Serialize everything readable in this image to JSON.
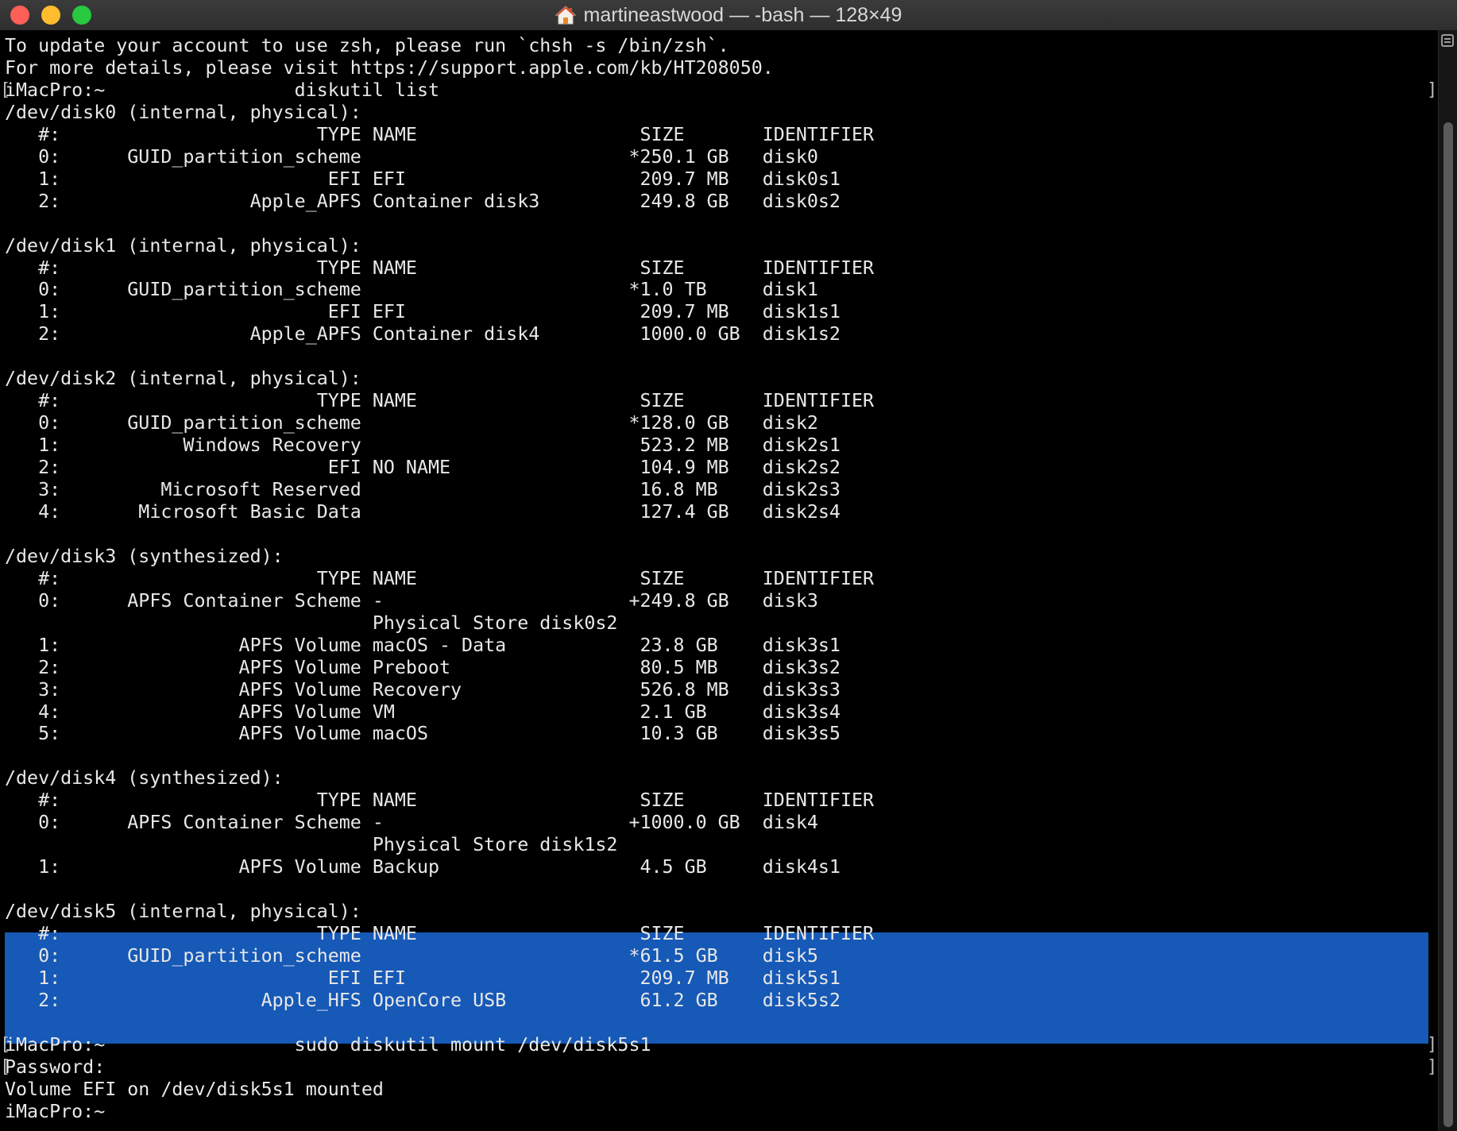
{
  "window": {
    "title": "martineastwood — -bash — 128×49",
    "controls": [
      "close",
      "minimize",
      "maximize"
    ],
    "title_icon": "home-icon"
  },
  "terminal": {
    "lines": [
      "To update your account to use zsh, please run `chsh -s /bin/zsh`.",
      "For more details, please visit https://support.apple.com/kb/HT208050.",
      "iMacPro:~                 diskutil list",
      "/dev/disk0 (internal, physical):",
      "   #:                       TYPE NAME                    SIZE       IDENTIFIER",
      "   0:      GUID_partition_scheme                        *250.1 GB   disk0",
      "   1:                        EFI EFI                     209.7 MB   disk0s1",
      "   2:                 Apple_APFS Container disk3         249.8 GB   disk0s2",
      "",
      "/dev/disk1 (internal, physical):",
      "   #:                       TYPE NAME                    SIZE       IDENTIFIER",
      "   0:      GUID_partition_scheme                        *1.0 TB     disk1",
      "   1:                        EFI EFI                     209.7 MB   disk1s1",
      "   2:                 Apple_APFS Container disk4         1000.0 GB  disk1s2",
      "",
      "/dev/disk2 (internal, physical):",
      "   #:                       TYPE NAME                    SIZE       IDENTIFIER",
      "   0:      GUID_partition_scheme                        *128.0 GB   disk2",
      "   1:           Windows Recovery                         523.2 MB   disk2s1",
      "   2:                        EFI NO NAME                 104.9 MB   disk2s2",
      "   3:         Microsoft Reserved                         16.8 MB    disk2s3",
      "   4:       Microsoft Basic Data                         127.4 GB   disk2s4",
      "",
      "/dev/disk3 (synthesized):",
      "   #:                       TYPE NAME                    SIZE       IDENTIFIER",
      "   0:      APFS Container Scheme -                      +249.8 GB   disk3",
      "                                 Physical Store disk0s2",
      "   1:                APFS Volume macOS - Data            23.8 GB    disk3s1",
      "   2:                APFS Volume Preboot                 80.5 MB    disk3s2",
      "   3:                APFS Volume Recovery                526.8 MB   disk3s3",
      "   4:                APFS Volume VM                      2.1 GB     disk3s4",
      "   5:                APFS Volume macOS                   10.3 GB    disk3s5",
      "",
      "/dev/disk4 (synthesized):",
      "   #:                       TYPE NAME                    SIZE       IDENTIFIER",
      "   0:      APFS Container Scheme -                      +1000.0 GB  disk4",
      "                                 Physical Store disk1s2",
      "   1:                APFS Volume Backup                  4.5 GB     disk4s1",
      "",
      "/dev/disk5 (internal, physical):",
      "   #:                       TYPE NAME                    SIZE       IDENTIFIER",
      "   0:      GUID_partition_scheme                        *61.5 GB    disk5",
      "   1:                        EFI EFI                     209.7 MB   disk5s1",
      "   2:                  Apple_HFS OpenCore USB            61.2 GB    disk5s2",
      "",
      "iMacPro:~                 sudo diskutil mount /dev/disk5s1",
      "Password:",
      "Volume EFI on /dev/disk5s1 mounted",
      "iMacPro:~ "
    ],
    "bracketed_lines": [
      2,
      45,
      46
    ],
    "selected_lines": [
      39,
      40,
      41,
      42,
      43
    ],
    "selection_color": "#1659b7",
    "text_color": "#e8e8e8",
    "background": "#000000"
  }
}
